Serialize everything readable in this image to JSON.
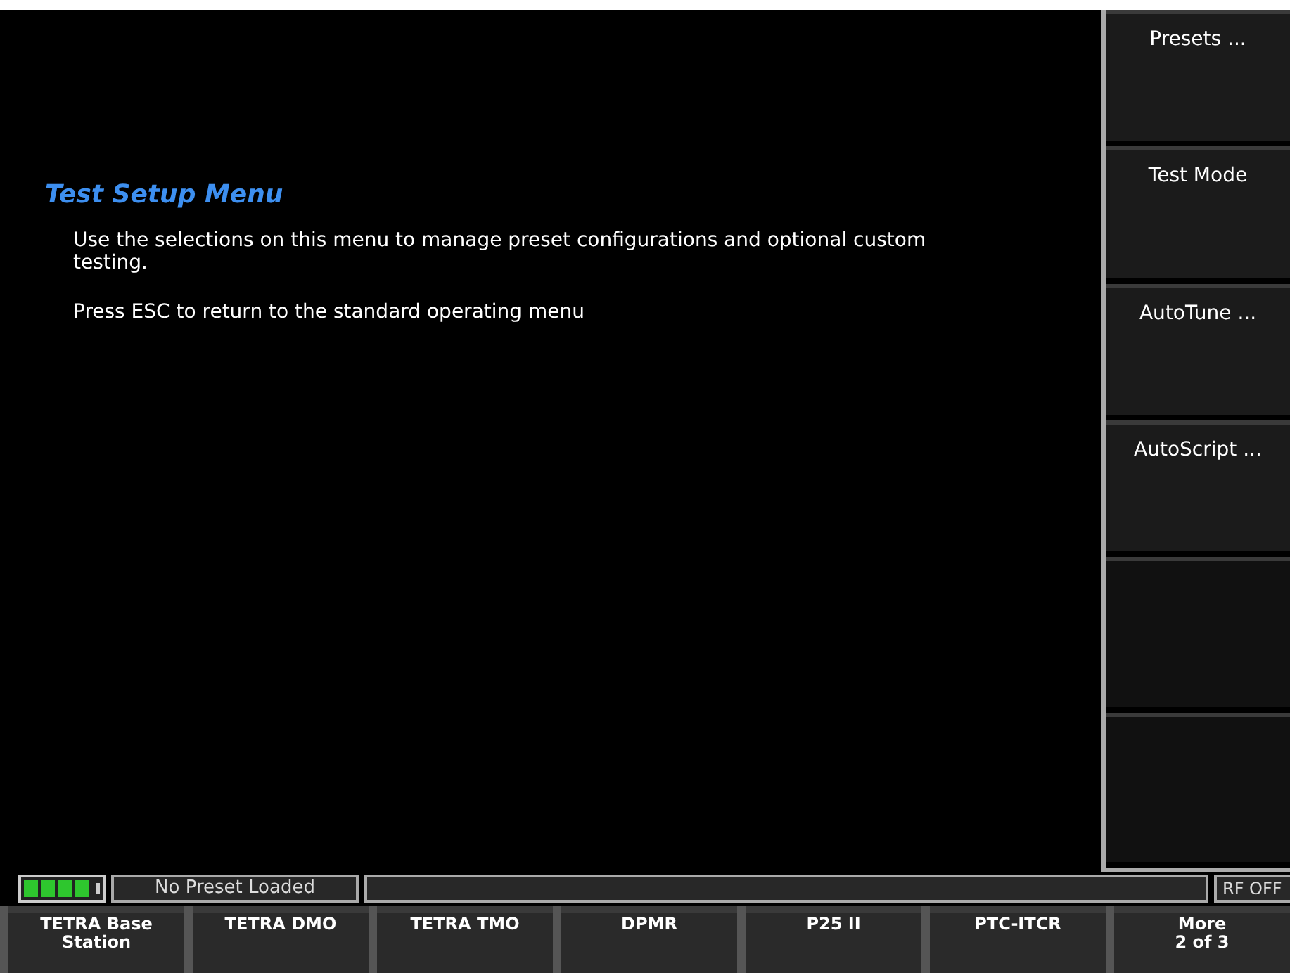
{
  "page": {
    "title": "Test Setup Menu",
    "paragraphs": [
      "Use the selections on this menu to manage preset configurations and optional custom testing.",
      "Press ESC to return to the standard operating menu"
    ]
  },
  "side_menu": [
    {
      "label": "Presets ..."
    },
    {
      "label": "Test Mode"
    },
    {
      "label": "AutoTune ..."
    },
    {
      "label": "AutoScript ..."
    }
  ],
  "status_bar": {
    "battery": {
      "level": 1
    },
    "preset": "No Preset Loaded",
    "rf_status": "RF OFF"
  },
  "soft_keys": [
    {
      "label": "TETRA Base\nStation"
    },
    {
      "label": "TETRA DMO"
    },
    {
      "label": "TETRA TMO"
    },
    {
      "label": "DPMR"
    },
    {
      "label": "P25 II"
    },
    {
      "label": "PTC-ITCR"
    },
    {
      "label": "More\n2 of 3"
    }
  ]
}
